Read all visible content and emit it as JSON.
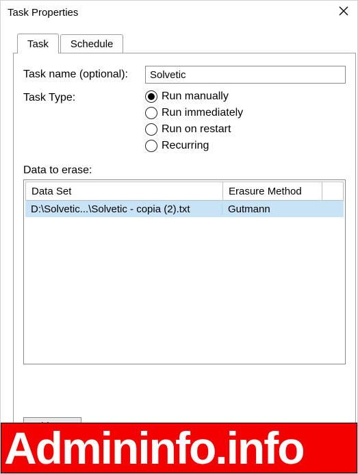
{
  "titlebar": {
    "title": "Task Properties"
  },
  "tabs": {
    "task": "Task",
    "schedule": "Schedule"
  },
  "form": {
    "task_name_label": "Task name (optional):",
    "task_name_value": "Solvetic",
    "task_type_label": "Task Type:",
    "radio_manual": "Run manually",
    "radio_immediate": "Run immediately",
    "radio_restart": "Run on restart",
    "radio_recurring": "Recurring"
  },
  "erase": {
    "section_label": "Data to erase:",
    "col_dataset": "Data Set",
    "col_method": "Erasure Method",
    "rows": [
      {
        "dataset": "D:\\Solvetic...\\Solvetic - copia (2).txt",
        "method": "Gutmann"
      }
    ],
    "add_button": "Add Data"
  },
  "watermark": {
    "text": "Admininfo.info"
  }
}
